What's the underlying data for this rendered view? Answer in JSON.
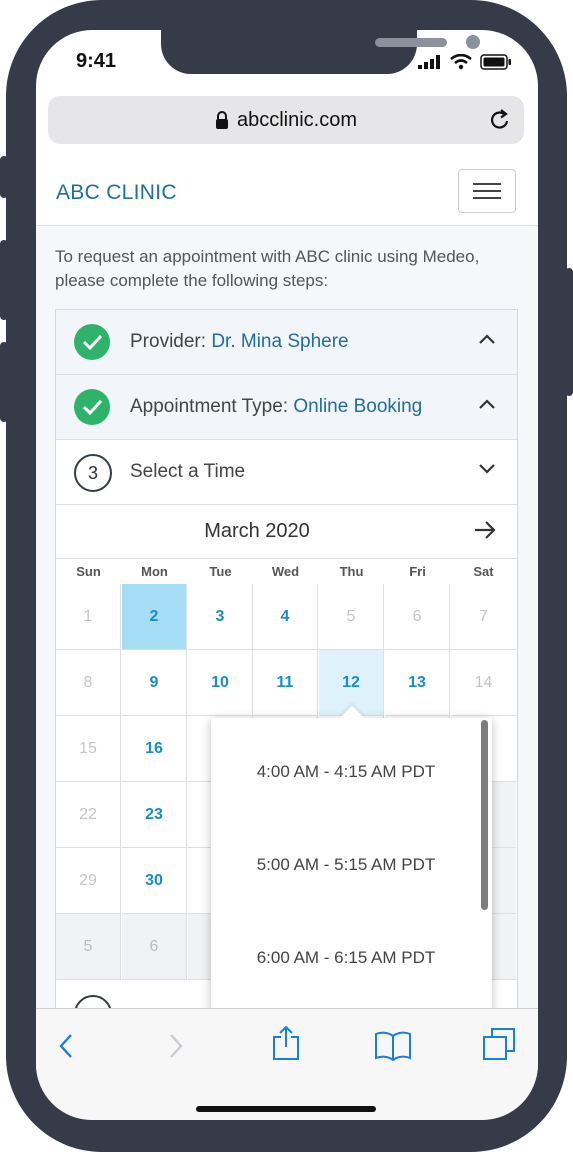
{
  "status_bar": {
    "time": "9:41"
  },
  "browser": {
    "url": "abcclinic.com"
  },
  "site": {
    "brand": "ABC CLINIC"
  },
  "intro": "To request an appointment with ABC clinic using Medeo, please complete the following steps:",
  "steps": [
    {
      "label": "Provider: ",
      "value": "Dr. Mina Sphere"
    },
    {
      "label": "Appointment Type: ",
      "value": "Online Booking"
    },
    {
      "number": "3",
      "label": "Select a Time"
    }
  ],
  "calendar": {
    "month": "March 2020",
    "weekdays": [
      "Sun",
      "Mon",
      "Tue",
      "Wed",
      "Thu",
      "Fri",
      "Sat"
    ],
    "days": [
      "1",
      "2",
      "3",
      "4",
      "5",
      "6",
      "7",
      "8",
      "9",
      "10",
      "11",
      "12",
      "13",
      "14",
      "15",
      "16",
      "22",
      "23",
      "29",
      "30",
      "5",
      "6"
    ],
    "selected_day": "2",
    "highlighted_day": "12"
  },
  "time_slots": [
    "4:00 AM - 4:15 AM PDT",
    "5:00 AM - 5:15 AM PDT",
    "6:00 AM - 6:15 AM PDT"
  ],
  "colors": {
    "brand": "#1f6ea0",
    "accent": "#1a8ccc",
    "success": "#2fb36b",
    "frame": "#353b48"
  }
}
